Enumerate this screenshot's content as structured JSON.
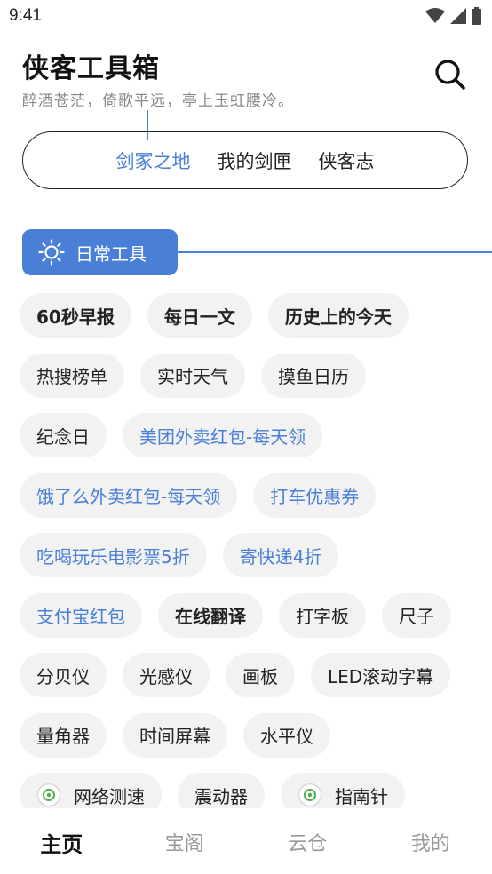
{
  "status": {
    "time": "9:41"
  },
  "header": {
    "title": "侠客工具箱",
    "subtitle": "醉酒苍茫，倚歌平远，亭上玉虹腰冷。"
  },
  "tabs": [
    {
      "label": "剑冢之地",
      "active": true
    },
    {
      "label": "我的剑匣",
      "active": false
    },
    {
      "label": "侠客志",
      "active": false
    }
  ],
  "section": {
    "label": "日常工具",
    "icon": "sun-icon"
  },
  "tools": [
    [
      "60秒早报",
      "每日一文",
      "历史上的今天"
    ],
    [
      "热搜榜单",
      "实时天气",
      "摸鱼日历"
    ],
    [
      "纪念日",
      "美团外卖红包-每天领"
    ],
    [
      "饿了么外卖红包-每天领",
      "打车优惠券"
    ],
    [
      "吃喝玩乐电影票5折",
      "寄快递4折"
    ],
    [
      "支付宝红包",
      "在线翻译",
      "打字板",
      "尺子"
    ],
    [
      "分贝仪",
      "光感仪",
      "画板",
      "LED滚动字幕"
    ],
    [
      "量角器",
      "时间屏幕",
      "水平仪"
    ],
    [
      "网络测速",
      "震动器",
      "指南针"
    ]
  ],
  "bottom_nav": [
    {
      "label": "主页",
      "active": true
    },
    {
      "label": "宝阁",
      "active": false
    },
    {
      "label": "云仓",
      "active": false
    },
    {
      "label": "我的",
      "active": false
    }
  ],
  "colors": {
    "accent": "#4a7fd8",
    "chip_bg": "#f2f2f2",
    "chip_icon": "#4caf50"
  }
}
